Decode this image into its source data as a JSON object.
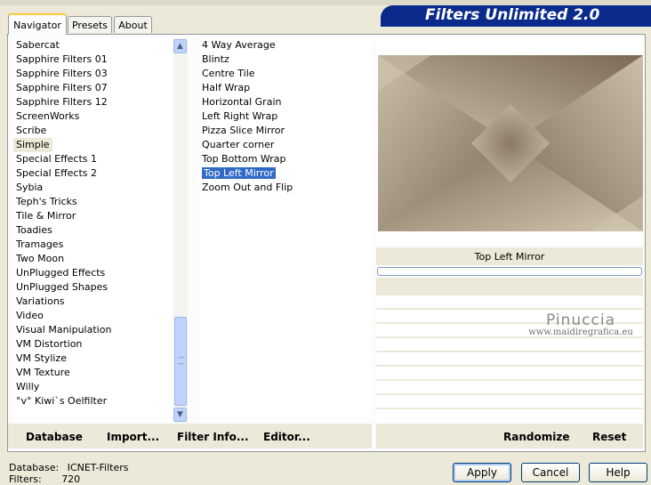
{
  "window": {
    "title": "Filters Unlimited 2.0"
  },
  "tabs": [
    {
      "label": "Navigator"
    },
    {
      "label": "Presets"
    },
    {
      "label": "About"
    }
  ],
  "categories": [
    "Sabercat",
    "Sapphire Filters 01",
    "Sapphire Filters 03",
    "Sapphire Filters 07",
    "Sapphire Filters 12",
    "ScreenWorks",
    "Scribe",
    "Simple",
    "Special Effects 1",
    "Special Effects 2",
    "Sybia",
    "Teph's Tricks",
    "Tile & Mirror",
    "Toadies",
    "Tramages",
    "Two Moon",
    "UnPlugged Effects",
    "UnPlugged Shapes",
    "Variations",
    "Video",
    "Visual Manipulation",
    "VM Distortion",
    "VM Stylize",
    "VM Texture",
    "Willy",
    "°v° Kiwi`s Oelfilter"
  ],
  "selected_category": "Simple",
  "filters": [
    "4 Way Average",
    "Blintz",
    "Centre Tile",
    "Half Wrap",
    "Horizontal Grain",
    "Left Right Wrap",
    "Pizza Slice Mirror",
    "Quarter corner",
    "Top Bottom Wrap",
    "Top Left Mirror",
    "Zoom Out and Flip"
  ],
  "selected_filter": "Top Left Mirror",
  "preview": {
    "filter_name": "Top Left Mirror",
    "colors": {
      "dark": "#7c6b57",
      "light": "#cbbfa8",
      "mid": "#a89782"
    }
  },
  "watermark": {
    "name": "Pinuccia",
    "url": "www.maidiregrafica.eu"
  },
  "toolbar": {
    "database": "Database",
    "import": "Import...",
    "filter_info": "Filter Info...",
    "editor": "Editor...",
    "randomize": "Randomize",
    "reset": "Reset"
  },
  "status": {
    "database_label": "Database:",
    "database_value": "ICNET-Filters",
    "filters_label": "Filters:",
    "filters_value": "720"
  },
  "buttons": {
    "apply": "Apply",
    "cancel": "Cancel",
    "help": "Help"
  },
  "accent": {
    "title_bar": "#0a2a8c",
    "selection": "#316ac5"
  }
}
